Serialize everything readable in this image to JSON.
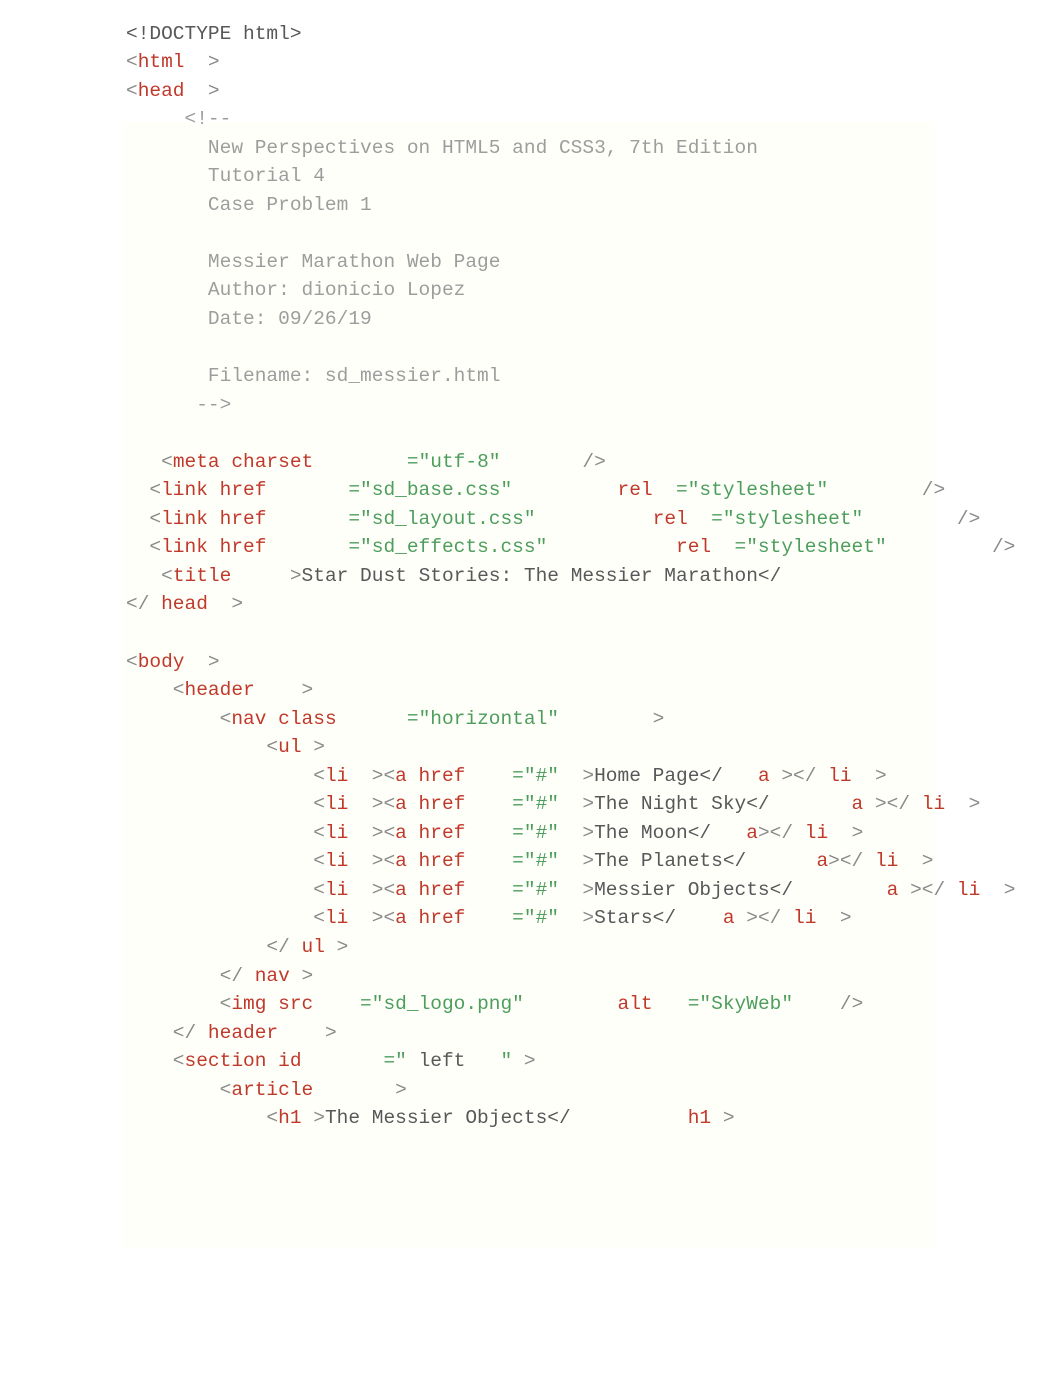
{
  "document": {
    "kind": "html-source-code-listing",
    "language": "HTML",
    "colors": {
      "page_background": "#ffffff",
      "panel_background": "#fffffa",
      "tag_name": "#c0392b",
      "attribute_name": "#c0392b",
      "attribute_value": "#4d9e5d",
      "bracket": "#8a8a8a",
      "text_content": "#58585a",
      "comment": "#9d9d9d",
      "doctype": "#58585a"
    }
  },
  "comment_block": {
    "open": "<!--",
    "lines": [
      "New Perspectives on HTML5 and CSS3, 7th Edition",
      "Tutorial 4",
      "Case Problem 1",
      "",
      "Messier Marathon Web Page",
      "Author: dionicio Lopez",
      "Date: 09/26/19",
      "",
      "Filename: sd_messier.html"
    ],
    "close": "-->"
  },
  "head": {
    "doctype": "<!DOCTYPE html>",
    "meta_charset": "utf-8",
    "stylesheets": [
      "sd_base.css",
      "sd_layout.css",
      "sd_effects.css"
    ],
    "rel_value": "stylesheet",
    "title": "Star Dust Stories: The Messier Marathon"
  },
  "body": {
    "nav_class": "horizontal",
    "nav_items": [
      "Home Page",
      "The Night Sky",
      "The Moon",
      "The Planets",
      "Messier Objects",
      "Stars"
    ],
    "link_href": "#",
    "logo": {
      "src": "sd_logo.png",
      "alt": "SkyWeb"
    },
    "section_id": " left ",
    "heading": "The Messier Objects"
  },
  "lines": [
    {
      "id": "l01",
      "indent": 0,
      "html": "<span class=\"doct\">&lt;!DOCTYPE html&gt;</span>"
    },
    {
      "id": "l02",
      "indent": 0,
      "html": "<span class=\"br\">&lt;</span><span class=\"tag\">html</span><span class=\"br\">  &gt;</span>"
    },
    {
      "id": "l03",
      "indent": 0,
      "html": "<span class=\"br\">&lt;</span><span class=\"tag\">head</span><span class=\"br\">  &gt;</span>"
    },
    {
      "id": "l04",
      "indent": 0,
      "html": "<span class=\"cmt\">     &lt;!--</span>"
    },
    {
      "id": "l05",
      "indent": 0,
      "html": "<span class=\"cmt\">       New Perspectives on HTML5 and CSS3, 7th Edition</span>"
    },
    {
      "id": "l06",
      "indent": 0,
      "html": "<span class=\"cmt\">       Tutorial 4</span>"
    },
    {
      "id": "l07",
      "indent": 0,
      "html": "<span class=\"cmt\">       Case Problem 1</span>"
    },
    {
      "id": "l08",
      "indent": 0,
      "html": " "
    },
    {
      "id": "l09",
      "indent": 0,
      "html": "<span class=\"cmt\">       Messier Marathon Web Page</span>"
    },
    {
      "id": "l10",
      "indent": 0,
      "html": "<span class=\"cmt\">       Author: dionicio Lopez</span>"
    },
    {
      "id": "l11",
      "indent": 0,
      "html": "<span class=\"cmt\">       Date: 09/26/19</span>"
    },
    {
      "id": "l12",
      "indent": 0,
      "html": " "
    },
    {
      "id": "l13",
      "indent": 0,
      "html": "<span class=\"cmt\">       Filename: sd_messier.html</span>"
    },
    {
      "id": "l14",
      "indent": 0,
      "html": "<span class=\"cmt\">      --&gt;</span>"
    },
    {
      "id": "l15",
      "indent": 0,
      "html": " "
    },
    {
      "id": "l16",
      "indent": 0,
      "html": "<span class=\"br\">   &lt;</span><span class=\"tag\">meta</span><span class=\"attr\"> charset</span><span class=\"val\">        =\"utf-8\"</span><span class=\"br\">       /&gt;</span>"
    },
    {
      "id": "l17",
      "indent": 0,
      "html": "<span class=\"br\">  &lt;</span><span class=\"tag\">link</span><span class=\"attr\"> href</span><span class=\"val\">       =\"sd_base.css\"</span><span class=\"attr\">         rel</span><span class=\"val\">  =\"stylesheet\"</span><span class=\"br\">        /&gt;</span>"
    },
    {
      "id": "l18",
      "indent": 0,
      "html": "<span class=\"br\">  &lt;</span><span class=\"tag\">link</span><span class=\"attr\"> href</span><span class=\"val\">       =\"sd_layout.css\"</span><span class=\"attr\">          rel</span><span class=\"val\">  =\"stylesheet\"</span><span class=\"br\">        /&gt;</span>"
    },
    {
      "id": "l19",
      "indent": 0,
      "html": "<span class=\"br\">  &lt;</span><span class=\"tag\">link</span><span class=\"attr\"> href</span><span class=\"val\">       =\"sd_effects.css\"</span><span class=\"attr\">           rel</span><span class=\"val\">  =\"stylesheet\"</span><span class=\"br\">         /&gt;</span>"
    },
    {
      "id": "l20",
      "indent": 0,
      "html": "<span class=\"br\">   &lt;</span><span class=\"tag\">title</span><span class=\"br\">     &gt;</span><span class=\"txt\">Star Dust Stories: The Messier Marathon&lt;/</span><span class=\"tag\">                        title</span><span class=\"br\">   &gt;</span>"
    },
    {
      "id": "l21",
      "indent": 0,
      "html": "<span class=\"br\">&lt;/</span><span class=\"tag\"> head</span><span class=\"br\">  &gt;</span>"
    },
    {
      "id": "l22",
      "indent": 0,
      "html": " "
    },
    {
      "id": "l23",
      "indent": 0,
      "html": "<span class=\"br\">&lt;</span><span class=\"tag\">body</span><span class=\"br\">  &gt;</span>"
    },
    {
      "id": "l24",
      "indent": 0,
      "html": "<span class=\"br\">    &lt;</span><span class=\"tag\">header</span><span class=\"br\">    &gt;</span>"
    },
    {
      "id": "l25",
      "indent": 0,
      "html": "<span class=\"br\">        &lt;</span><span class=\"tag\">nav</span><span class=\"attr\"> class</span><span class=\"val\">      =\"horizontal\"</span><span class=\"br\">        &gt;</span>"
    },
    {
      "id": "l26",
      "indent": 0,
      "html": "<span class=\"br\">            &lt;</span><span class=\"tag\">ul</span><span class=\"br\"> &gt;</span>"
    },
    {
      "id": "l27",
      "indent": 0,
      "html": "<span class=\"br\">                &lt;</span><span class=\"tag\">li</span><span class=\"br\">  &gt;&lt;</span><span class=\"tag\">a</span><span class=\"attr\"> href</span><span class=\"val\">    =\"#\"</span><span class=\"br\">  &gt;</span><span class=\"txt\">Home Page&lt;/</span><span class=\"tag\">   a</span><span class=\"br\"> &gt;&lt;/</span><span class=\"tag\"> li</span><span class=\"br\">  &gt;</span>"
    },
    {
      "id": "l28",
      "indent": 0,
      "html": "<span class=\"br\">                &lt;</span><span class=\"tag\">li</span><span class=\"br\">  &gt;&lt;</span><span class=\"tag\">a</span><span class=\"attr\"> href</span><span class=\"val\">    =\"#\"</span><span class=\"br\">  &gt;</span><span class=\"txt\">The Night Sky&lt;/</span><span class=\"tag\">       a</span><span class=\"br\"> &gt;&lt;/</span><span class=\"tag\"> li</span><span class=\"br\">  &gt;</span>"
    },
    {
      "id": "l29",
      "indent": 0,
      "html": "<span class=\"br\">                &lt;</span><span class=\"tag\">li</span><span class=\"br\">  &gt;&lt;</span><span class=\"tag\">a</span><span class=\"attr\"> href</span><span class=\"val\">    =\"#\"</span><span class=\"br\">  &gt;</span><span class=\"txt\">The Moon&lt;/</span><span class=\"tag\">   a</span><span class=\"br\">&gt;&lt;/</span><span class=\"tag\"> li</span><span class=\"br\">  &gt;</span>"
    },
    {
      "id": "l30",
      "indent": 0,
      "html": "<span class=\"br\">                &lt;</span><span class=\"tag\">li</span><span class=\"br\">  &gt;&lt;</span><span class=\"tag\">a</span><span class=\"attr\"> href</span><span class=\"val\">    =\"#\"</span><span class=\"br\">  &gt;</span><span class=\"txt\">The Planets&lt;/</span><span class=\"tag\">      a</span><span class=\"br\">&gt;&lt;/</span><span class=\"tag\"> li</span><span class=\"br\">  &gt;</span>"
    },
    {
      "id": "l31",
      "indent": 0,
      "html": "<span class=\"br\">                &lt;</span><span class=\"tag\">li</span><span class=\"br\">  &gt;&lt;</span><span class=\"tag\">a</span><span class=\"attr\"> href</span><span class=\"val\">    =\"#\"</span><span class=\"br\">  &gt;</span><span class=\"txt\">Messier Objects&lt;/</span><span class=\"tag\">        a</span><span class=\"br\"> &gt;&lt;/</span><span class=\"tag\"> li</span><span class=\"br\">  &gt;</span>"
    },
    {
      "id": "l32",
      "indent": 0,
      "html": "<span class=\"br\">                &lt;</span><span class=\"tag\">li</span><span class=\"br\">  &gt;&lt;</span><span class=\"tag\">a</span><span class=\"attr\"> href</span><span class=\"val\">    =\"#\"</span><span class=\"br\">  &gt;</span><span class=\"txt\">Stars&lt;/</span><span class=\"tag\">    a</span><span class=\"br\"> &gt;&lt;/</span><span class=\"tag\"> li</span><span class=\"br\">  &gt;</span>"
    },
    {
      "id": "l33",
      "indent": 0,
      "html": "<span class=\"br\">            &lt;/</span><span class=\"tag\"> ul</span><span class=\"br\"> &gt;</span>"
    },
    {
      "id": "l34",
      "indent": 0,
      "html": "<span class=\"br\">        &lt;/</span><span class=\"tag\"> nav</span><span class=\"br\"> &gt;</span>"
    },
    {
      "id": "l35",
      "indent": 0,
      "html": "<span class=\"br\">        &lt;</span><span class=\"tag\">img</span><span class=\"attr\"> src</span><span class=\"val\">    =\"sd_logo.png\"</span><span class=\"attr\">        alt</span><span class=\"val\">   =\"SkyWeb\"</span><span class=\"br\">    /&gt;</span>"
    },
    {
      "id": "l36",
      "indent": 0,
      "html": "<span class=\"br\">    &lt;/</span><span class=\"tag\"> header</span><span class=\"br\">    &gt;</span>"
    },
    {
      "id": "l37",
      "indent": 0,
      "html": "<span class=\"br\">    &lt;</span><span class=\"tag\">section</span><span class=\"attr\"> id</span><span class=\"val\">       =\"</span><span class=\"txt\"> left </span><span class=\"val\">  \"</span><span class=\"br\"> &gt;</span>"
    },
    {
      "id": "l38",
      "indent": 0,
      "html": "<span class=\"br\">        &lt;</span><span class=\"tag\">article</span><span class=\"br\">       &gt;</span>"
    },
    {
      "id": "l39",
      "indent": 0,
      "html": "<span class=\"br\">            &lt;</span><span class=\"tag\">h1</span><span class=\"br\"> &gt;</span><span class=\"txt\">The Messier Objects&lt;/</span><span class=\"tag\">          h1</span><span class=\"br\"> &gt;</span>"
    }
  ]
}
